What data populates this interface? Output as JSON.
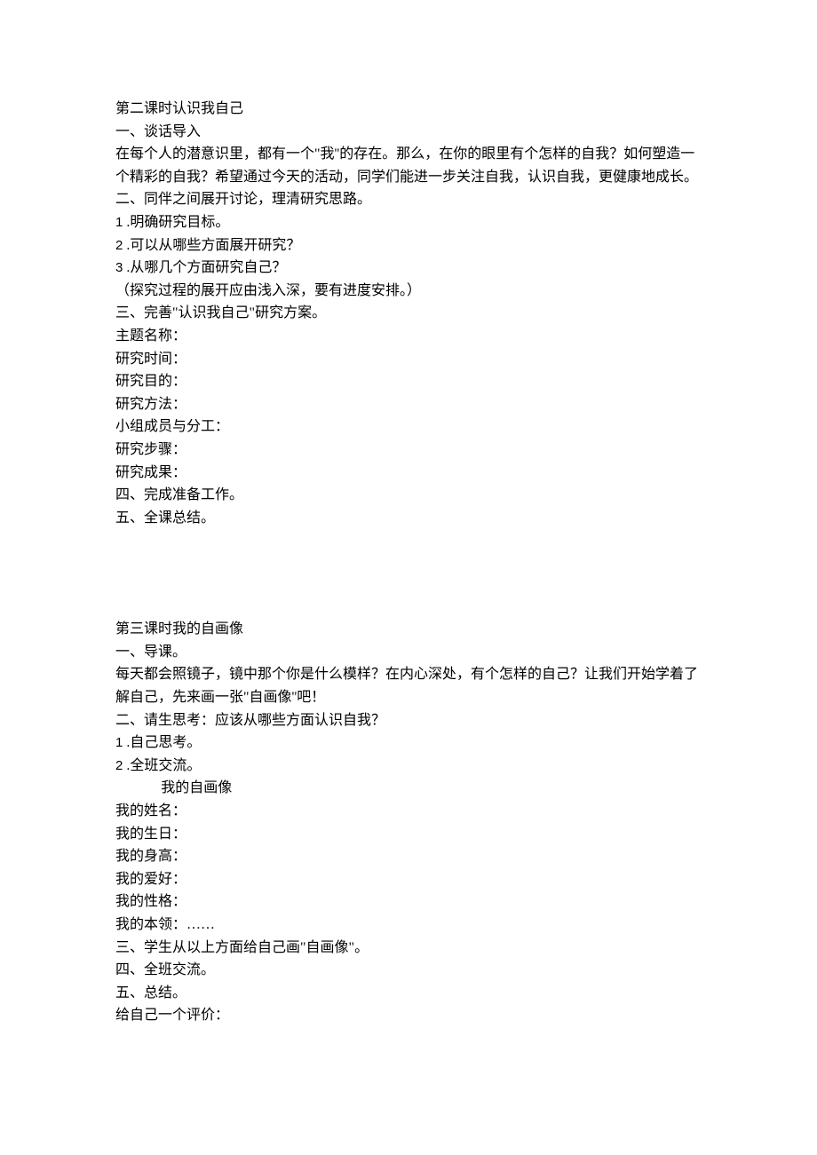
{
  "section2": {
    "title": "第二课时认识我自己",
    "h1": "一、谈话导入",
    "p1": "在每个人的潜意识里，都有一个\"我''的存在。那么，在你的眼里有个怎样的自我？如何塑造一个精彩的自我？希望通过今天的活动，同学们能进一步关注自我，认识自我，更健康地成长。",
    "h2": "二、同伴之间展开讨论，理清研究思路。",
    "list": {
      "i1_num": "1",
      "i1_text": " .明确研究目标。",
      "i2_num": "2",
      "i2_text": " .可以从哪些方面展开研究？",
      "i3_num": "3",
      "i3_text": " .从哪几个方面研究自己？"
    },
    "note": "（探究过程的展开应由浅入深，要有进度安排。）",
    "h3": "三、完善\"认识我自己\"研究方案。",
    "fields": {
      "f1": "主题名称：",
      "f2": "研究时间：",
      "f3": "研究目的：",
      "f4": "研究方法：",
      "f5": "小组成员与分工：",
      "f6": "研究步骤：",
      "f7": "研究成果："
    },
    "h4": "四、完成准备工作。",
    "h5": "五、全课总结。"
  },
  "section3": {
    "title": "第三课时我的自画像",
    "h1": "一、导课。",
    "p1": "每天都会照镜子，镜中那个你是什么模样？在内心深处，有个怎样的自己？让我们开始学着了解自己，先来画一张\"自画像''吧！",
    "h2": "二、请生思考：应该从哪些方面认识自我？",
    "list": {
      "i1_num": "1",
      "i1_text": " .自己思考。",
      "i2_num": "2",
      "i2_text": " .全班交流。"
    },
    "subtitle": "我的自画像",
    "fields": {
      "f1": "我的姓名：",
      "f2": "我的生日：",
      "f3": "我的身高：",
      "f4": "我的爱好：",
      "f5": "我的性格：",
      "f6": "我的本领：……"
    },
    "h3": "三、学生从以上方面给自己画\"自画像\"。",
    "h4": "四、全班交流。",
    "h5": "五、总结。",
    "footer": "给自己一个评价："
  }
}
